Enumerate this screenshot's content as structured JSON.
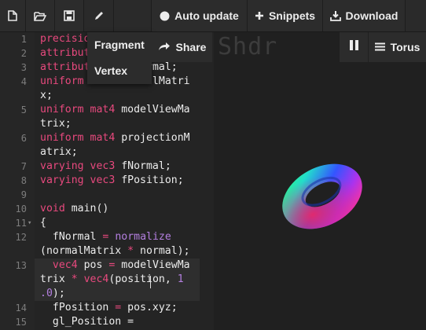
{
  "toolbar": {
    "new_icon": "new-file-icon",
    "open_icon": "open-folder-icon",
    "save_icon": "save-icon",
    "edit_icon": "pencil-icon",
    "auto_update_label": "Auto update",
    "snippets_label": "Snippets",
    "download_label": "Download"
  },
  "shader_menu": {
    "items": [
      {
        "label": "Fragment"
      },
      {
        "label": "Vertex"
      }
    ]
  },
  "share": {
    "label": "Share"
  },
  "preview": {
    "brand": "Shdr",
    "model_label": "Torus",
    "pause_icon": "pause-icon"
  },
  "editor": {
    "lines": [
      {
        "num": "1",
        "text": "precision highp float;"
      },
      {
        "num": "2",
        "text": "attribute vec3 position;"
      },
      {
        "num": "3",
        "text": "attribute vec3 normal;"
      },
      {
        "num": "4",
        "text": "uniform mat3 normalMatrix;"
      },
      {
        "num": "5",
        "text": "uniform mat4 modelViewMatrix;"
      },
      {
        "num": "6",
        "text": "uniform mat4 projectionMatrix;"
      },
      {
        "num": "7",
        "text": "varying vec3 fNormal;"
      },
      {
        "num": "8",
        "text": "varying vec3 fPosition;"
      },
      {
        "num": "9",
        "text": ""
      },
      {
        "num": "10",
        "text": "void main()"
      },
      {
        "num": "11",
        "text": "{"
      },
      {
        "num": "12",
        "text": "  fNormal = normalize(normalMatrix * normal);"
      },
      {
        "num": "13",
        "text": "  vec4 pos = modelViewMatrix * vec4(position, 1.0);"
      },
      {
        "num": "14",
        "text": "  fPosition = pos.xyz;"
      },
      {
        "num": "15",
        "text": "  gl_Position ="
      }
    ]
  },
  "colors": {
    "keyword": "#e8497e",
    "builtin": "#b47fe0",
    "text": "#ececec",
    "background": "#242424"
  }
}
